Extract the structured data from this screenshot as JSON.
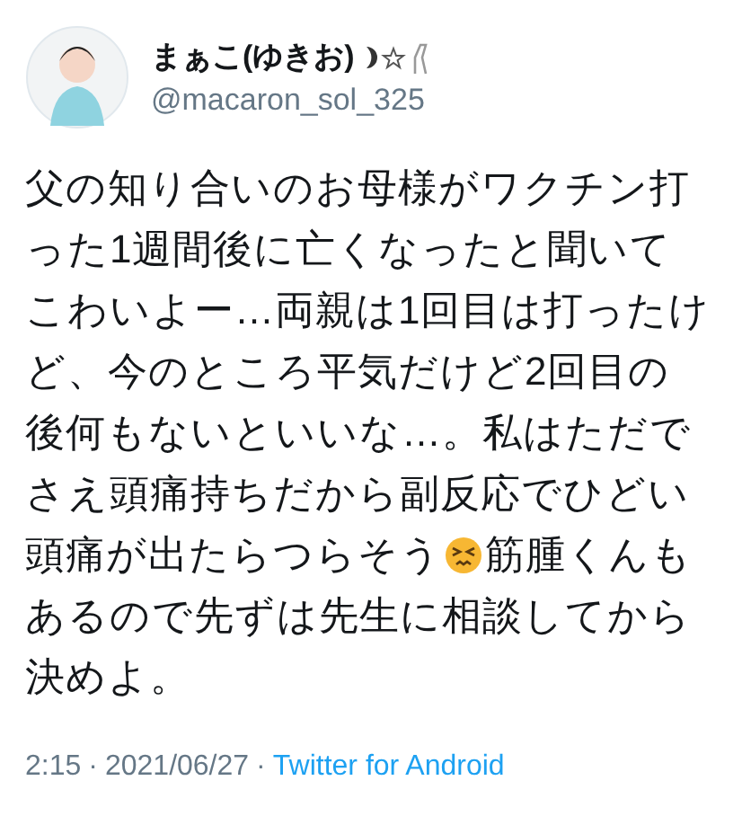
{
  "author": {
    "name": "まぁこ(ゆきお)",
    "handle": "@macaron_sol_325"
  },
  "body": [
    [
      {
        "kind": "text",
        "text": "父の知り合いのお母様がワクチン打"
      }
    ],
    [
      {
        "kind": "text",
        "text": "った1週間後に亡くなったと聞いて"
      }
    ],
    [
      {
        "kind": "text",
        "text": "こわいよー…両親は1回目は打ったけ"
      }
    ],
    [
      {
        "kind": "text",
        "text": "ど、今のところ平気だけど2回目の"
      }
    ],
    [
      {
        "kind": "text",
        "text": "後何もないといいな…。私はただで"
      }
    ],
    [
      {
        "kind": "text",
        "text": "さえ頭痛持ちだから副反応でひどい"
      }
    ],
    [
      {
        "kind": "text",
        "text": "頭痛が出たらつらそう"
      },
      {
        "kind": "emoji"
      },
      {
        "kind": "text",
        "text": "筋腫くんも"
      }
    ],
    [
      {
        "kind": "text",
        "text": "あるので先ずは先生に相談してから"
      }
    ],
    [
      {
        "kind": "text",
        "text": "決めよ。"
      }
    ]
  ],
  "meta": {
    "time": "2:15",
    "separator_1": "·",
    "date": "2021/06/27",
    "separator_2": "·",
    "source": "Twitter for Android"
  }
}
